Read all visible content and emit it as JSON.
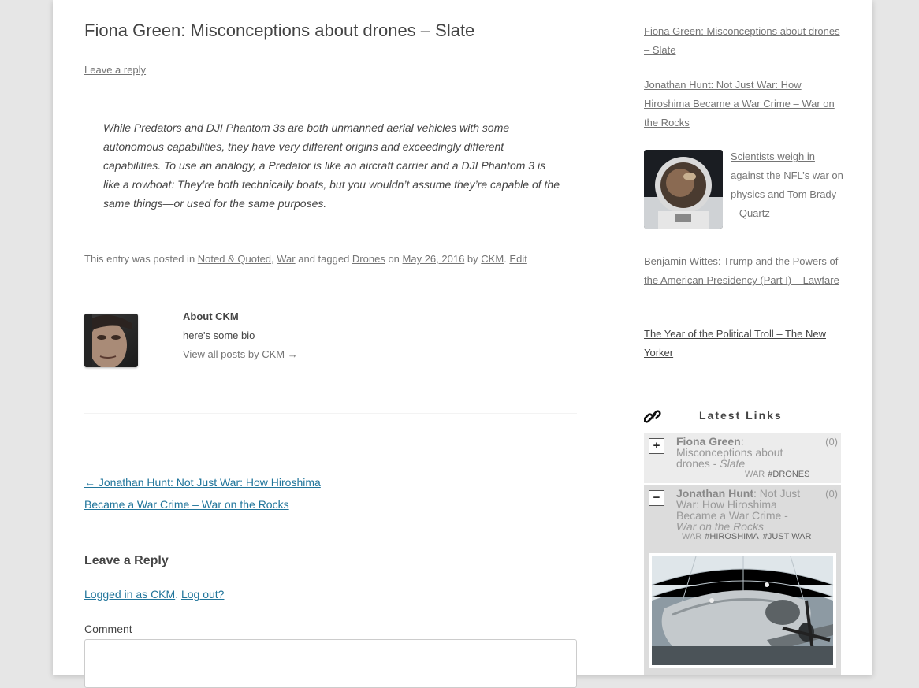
{
  "post": {
    "title": "Fiona Green: Misconceptions about drones – Slate",
    "leave_reply": "Leave a reply",
    "quote": "While Predators and DJI Phantom 3s are both unmanned aerial vehicles with some autonomous capabilities, they have very different origins and exceedingly different capabilities. To use an analogy, a Predator is like an aircraft carrier and a DJI Phantom 3 is like a rowboat: They’re both technically boats, but you wouldn’t assume they’re capable of the same things—or used for the same purposes.",
    "meta": {
      "prefix": "This entry was posted in ",
      "cat1": "Noted & Quoted",
      "sep1": ", ",
      "cat2": "War",
      "tagged": " and tagged ",
      "tag1": "Drones",
      "on": " on ",
      "date": "May 26, 2016",
      "by": " by ",
      "author": "CKM",
      "dot": ". ",
      "edit": "Edit"
    }
  },
  "author_box": {
    "title": "About CKM",
    "bio": "here's some bio",
    "view_all": "View all posts by CKM →"
  },
  "nav": {
    "prev": "← Jonathan Hunt: Not Just War: How Hiroshima Became a War Crime – War on the Rocks"
  },
  "reply": {
    "title": "Leave a Reply",
    "logged_in": "Logged in as CKM",
    "sep": ". ",
    "logout": "Log out?",
    "comment_label": "Comment"
  },
  "sidebar": {
    "links": [
      "Fiona Green: Misconceptions about drones – Slate",
      "Jonathan Hunt: Not Just War: How Hiroshima Became a War Crime – War on the Rocks",
      "Scientists weigh in against the NFL’s war on physics and Tom Brady – Quartz",
      "Benjamin Wittes: Trump and the Powers of the American Presidency (Part I) – Lawfare",
      "The Year of the Political Troll – The New Yorker"
    ],
    "latest_links": {
      "title": "Latest Links",
      "items": [
        {
          "toggle": "+",
          "author": "Fiona Green",
          "colon": ":",
          "text": " Misconceptions about drones - ",
          "source": "Slate",
          "count": "(0)",
          "category": "WAR",
          "tags": [
            "#DRONES"
          ]
        },
        {
          "toggle": "−",
          "author": "Jonathan Hunt",
          "colon": ":",
          "text": " Not Just War: How Hiroshima Became a War Crime - ",
          "source": "War on the Rocks",
          "count": "(0)",
          "category": "WAR",
          "tags": [
            "#HIROSHIMA",
            "#JUST WAR"
          ]
        }
      ]
    }
  }
}
